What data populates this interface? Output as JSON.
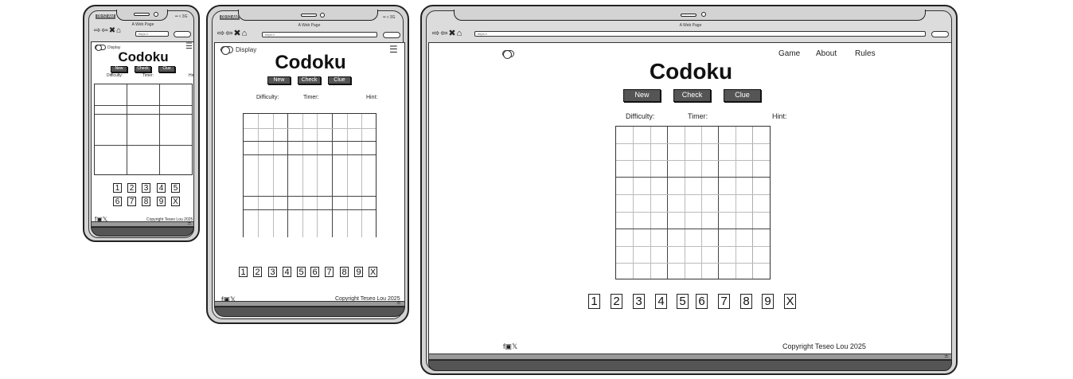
{
  "browser": {
    "page_title": "A Web Page",
    "url": "https://",
    "time": "09:52 AM",
    "signal": "•• ▿ 3G"
  },
  "app": {
    "title": "Codoku",
    "display_label": "Display",
    "buttons": {
      "new": "New",
      "check": "Check",
      "clue": "Clue"
    },
    "labels": {
      "difficulty": "Difficulty:",
      "timer": "Timer:",
      "hint": "Hint:"
    },
    "number_pad": [
      "1",
      "2",
      "3",
      "4",
      "5",
      "6",
      "7",
      "8",
      "9",
      "X"
    ],
    "nav": [
      "Game",
      "About",
      "Rules"
    ],
    "copyright": "Copyright Teseo Lou 2025",
    "social_icons": [
      "facebook-icon",
      "instagram-icon",
      "x-icon"
    ]
  }
}
